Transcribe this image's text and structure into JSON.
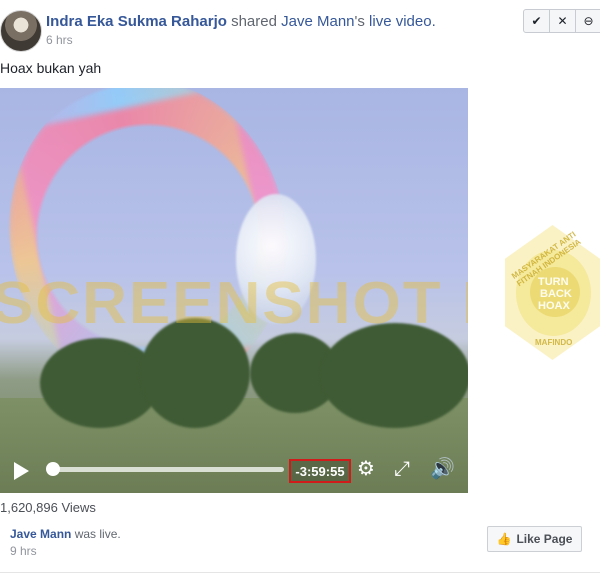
{
  "post": {
    "author": "Indra Eka Sukma Raharjo",
    "shared_text": "shared",
    "owner": "Jave Mann",
    "possessive": "'s",
    "object": "live video.",
    "time": "6 hrs",
    "message": "Hoax bukan yah"
  },
  "controls": {
    "check_icon": "check-icon",
    "close_icon": "close-icon",
    "minus_icon": "minus-icon"
  },
  "video": {
    "watermark": "SCREENSHOT BY",
    "time_remaining": "-3:59:55",
    "views": "1,620,896 Views",
    "progress": 0.0
  },
  "live": {
    "name": "Jave Mann",
    "status": "was live.",
    "time": "9 hrs",
    "like_label": "Like Page"
  },
  "badge": {
    "line1": "TURN",
    "line2": "BACK",
    "line3": "HOAX",
    "ring_top": "MASYARAKAT ANTI FITNAH INDONESIA",
    "ring_bottom": "MAFINDO"
  },
  "colors": {
    "link": "#365899",
    "muted": "#90949c",
    "timestamp_box": "#d11a1a"
  }
}
